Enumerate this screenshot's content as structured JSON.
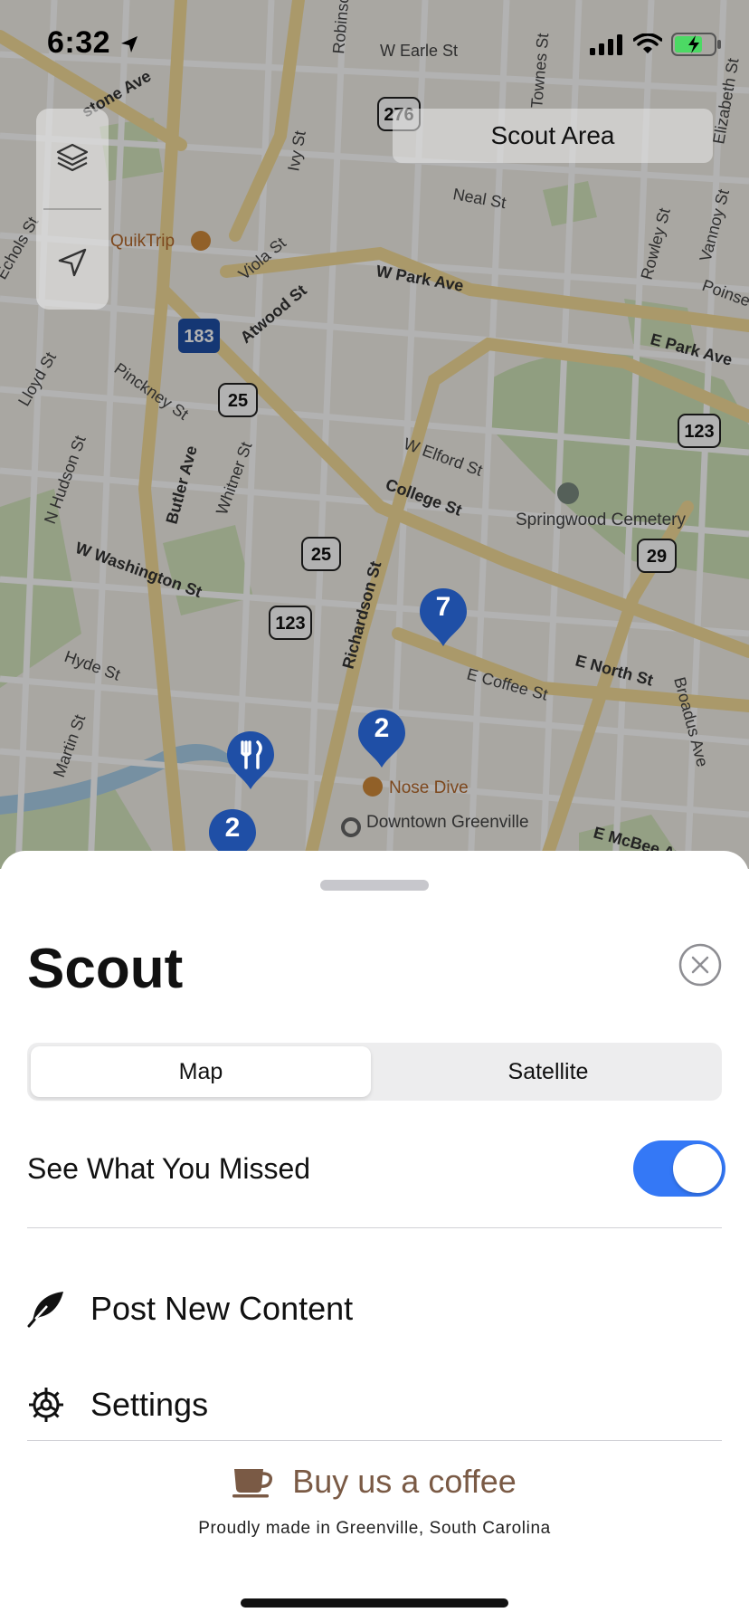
{
  "status_bar": {
    "time": "6:32"
  },
  "map": {
    "scout_area_label": "Scout Area",
    "street_labels": [
      "W Earle St",
      "Townes St",
      "Robinson St",
      "Elizabeth St",
      "Neal St",
      "Ivy St",
      "Viola St",
      "W Park Ave",
      "E Park Ave",
      "Atwood St",
      "Pinckney St",
      "Lloyd St",
      "Echols St",
      "N Hudson St",
      "Butler Ave",
      "Whitner St",
      "W Elford St",
      "College St",
      "W Washington St",
      "Richardson St",
      "Hyde St",
      "Martin St",
      "E Coffee St",
      "E North St",
      "Broadus Ave",
      "E McBee Ave",
      "Rowley St",
      "Vannoy St",
      "Poinsett",
      "stone Ave"
    ],
    "poi_labels": [
      "QuikTrip",
      "Springwood Cemetery",
      "Nose Dive",
      "Downtown Greenville"
    ],
    "route_shields": [
      "276",
      "183",
      "25",
      "25",
      "123",
      "123",
      "29"
    ],
    "pins": [
      "7",
      "2",
      "2"
    ],
    "restaurant_pin_icon": "fork-knife-icon"
  },
  "sheet": {
    "title": "Scout",
    "segmented": {
      "options": [
        "Map",
        "Satellite"
      ],
      "selected": "Map"
    },
    "toggle": {
      "label": "See What You Missed",
      "on": true,
      "color": "#3478f6"
    },
    "menu": [
      {
        "label": "Post New Content",
        "icon": "feather-icon"
      },
      {
        "label": "Settings",
        "icon": "gear-icon"
      }
    ],
    "coffee": {
      "label": "Buy us a coffee",
      "icon": "coffee-cup-icon",
      "color": "#7a5a45"
    },
    "tagline": "Proudly made in Greenville, South Carolina"
  },
  "colors": {
    "pin": "#1f4fa6",
    "accent": "#3478f6"
  }
}
